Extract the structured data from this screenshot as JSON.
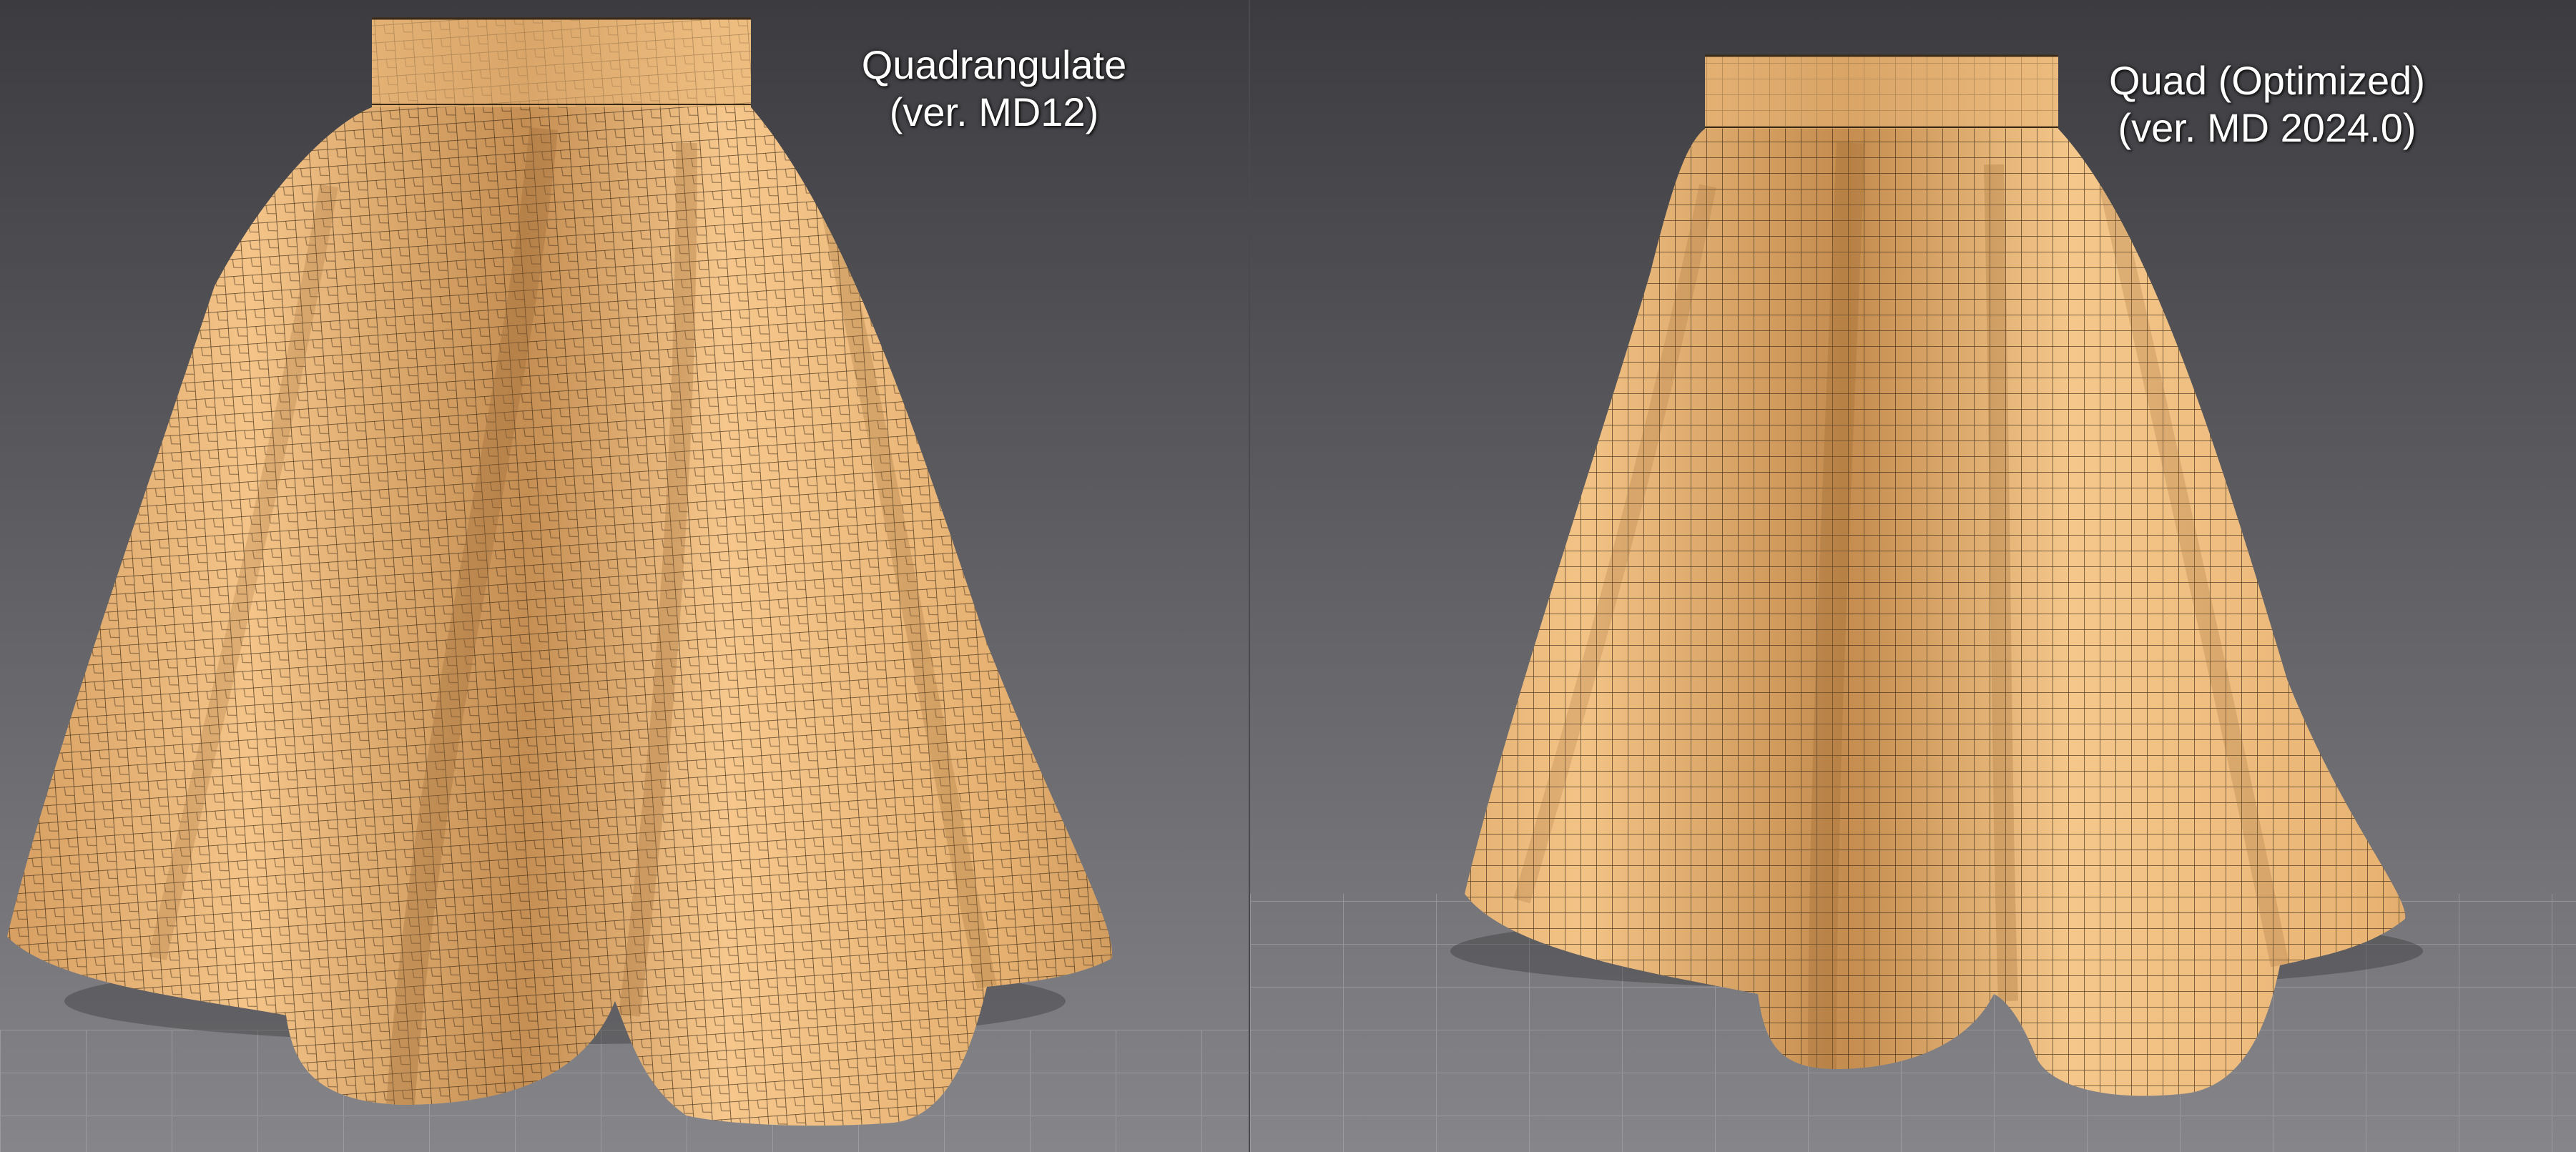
{
  "panels": [
    {
      "id": "left",
      "title_line1": "Quadrangulate",
      "title_line2": "(ver. MD12)",
      "mesh_style": "irregular"
    },
    {
      "id": "right",
      "title_line1": "Quad (Optimized)",
      "title_line2": "(ver. MD 2024.0)",
      "mesh_style": "regular"
    }
  ],
  "colors": {
    "background_top": "#3c3c40",
    "background_bottom": "#86868a",
    "fabric": "#f1bd7e",
    "fabric_shadow": "#b9854a",
    "mesh_line": "#3b2a18",
    "floor_grid": "#a4a4a8",
    "label_text": "#ffffff"
  }
}
